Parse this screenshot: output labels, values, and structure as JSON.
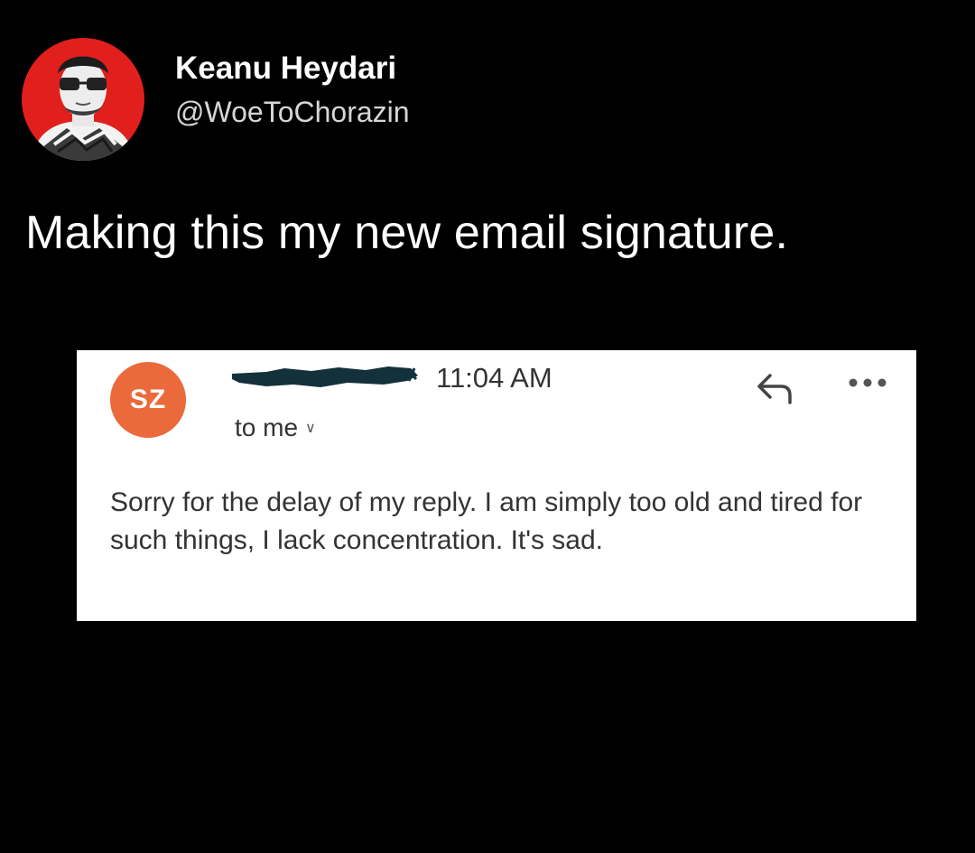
{
  "tweet": {
    "author_name": "Keanu Heydari",
    "author_handle": "@WoeToChorazin",
    "text": "Making this my new email signature."
  },
  "email": {
    "sender_initials": "SZ",
    "sender_avatar_color": "#ea6a3c",
    "time": "11:04 AM",
    "recipient": "to me",
    "body": "Sorry for the delay of my reply. I am simply too old and tired for such things, I lack concentration. It's sad.",
    "icons": {
      "reply": "reply-arrow-icon",
      "more": "more-dots-icon",
      "expand": "chevron-down-icon"
    }
  },
  "colors": {
    "background": "#000000",
    "avatar_ring": "#e1201d",
    "card": "#ffffff"
  }
}
